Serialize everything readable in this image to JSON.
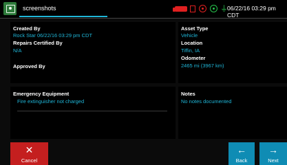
{
  "topbar": {
    "title": "screenshots",
    "datetime": "06/22/16 03:29 pm CDT",
    "icons": [
      "app-icon",
      "truck-icon",
      "document-icon",
      "gps-icon",
      "signal-icon",
      "plug-icon"
    ]
  },
  "created_panel": {
    "created_by_label": "Created By",
    "created_by_value": "Rock Star 06/22/16 03:29 pm CDT",
    "repairs_label": "Repairs Certified By",
    "repairs_value": "N/A",
    "approved_label": "Approved By"
  },
  "asset_panel": {
    "asset_type_label": "Asset Type",
    "asset_type_value": "Vehicle",
    "location_label": "Location",
    "location_value": "Tiffin, IA",
    "odometer_label": "Odometer",
    "odometer_value": "2465 mi (3967 km)"
  },
  "emergency_panel": {
    "label": "Emergency Equipment",
    "value": "Fire extinguisher not charged"
  },
  "notes_panel": {
    "label": "Notes",
    "value": "No notes documented"
  },
  "buttons": {
    "cancel_glyph": "✕",
    "cancel_label": "Cancel",
    "back_glyph": "←",
    "back_label": "Back",
    "next_glyph": "→",
    "next_label": "Next"
  },
  "colors": {
    "accent": "#1fb6d8",
    "cancel": "#c41f1f",
    "nav": "#0f8cb4",
    "alert": "#e02020",
    "ok": "#27c24c"
  }
}
